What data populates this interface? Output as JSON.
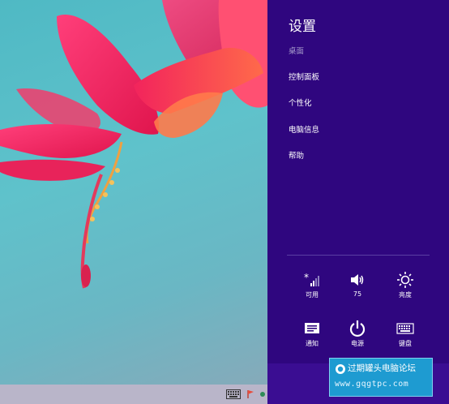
{
  "charms_panel": {
    "title": "设置",
    "items": [
      {
        "label": "桌面",
        "dim": true
      },
      {
        "label": "控制面板",
        "dim": false
      },
      {
        "label": "个性化",
        "dim": false
      },
      {
        "label": "电脑信息",
        "dim": false
      },
      {
        "label": "帮助",
        "dim": false
      }
    ],
    "tiles_row1": [
      {
        "icon": "network-icon",
        "label": "可用"
      },
      {
        "icon": "volume-icon",
        "label": "75"
      },
      {
        "icon": "brightness-icon",
        "label": "亮度"
      }
    ],
    "tiles_row2": [
      {
        "icon": "notifications-icon",
        "label": "通知"
      },
      {
        "icon": "power-icon",
        "label": "电源"
      },
      {
        "icon": "keyboard-icon",
        "label": "键盘"
      }
    ],
    "background_color": "#2f067f"
  },
  "watermark": {
    "title": "过期罐头电脑论坛",
    "url": "www.gqgtpc.com"
  }
}
